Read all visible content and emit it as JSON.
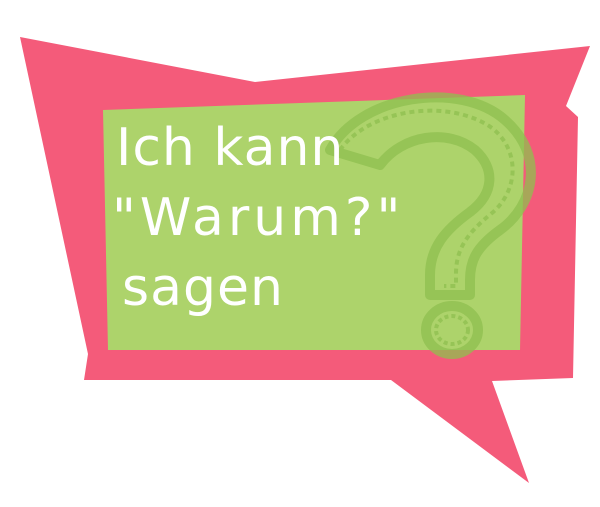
{
  "bubble": {
    "text_lines": [
      "Ich kann",
      "\"Warum?\"",
      "sagen"
    ],
    "colors": {
      "outer_bubble": "#f45b7a",
      "inner_panel": "#add36b",
      "question_mark_outline": "#8fbf4f",
      "text": "#ffffff",
      "background": "#ffffff"
    },
    "icons": {
      "watermark": "question-mark-icon"
    }
  }
}
